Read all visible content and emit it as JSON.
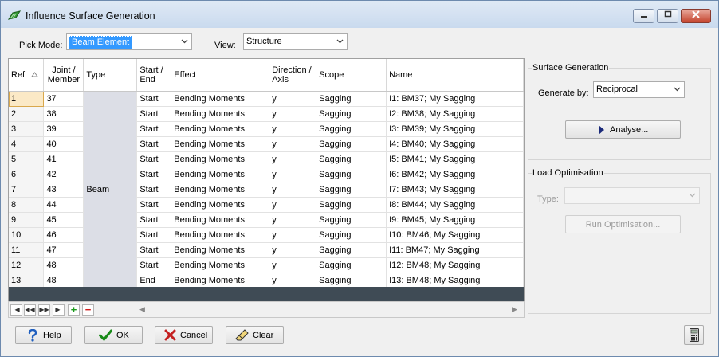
{
  "window": {
    "title": "Influence Surface Generation"
  },
  "pick_mode": {
    "label": "Pick Mode:",
    "value": "Beam Element"
  },
  "view": {
    "label": "View:",
    "value": "Structure"
  },
  "grid": {
    "headers": {
      "ref": "Ref",
      "joint_line1": "Joint /",
      "joint_line2": "Member",
      "type": "Type",
      "startend_line1": "Start /",
      "startend_line2": "End",
      "effect": "Effect",
      "direction_line1": "Direction /",
      "direction_line2": "Axis",
      "scope": "Scope",
      "name": "Name"
    },
    "type_value": "Beam",
    "rows": [
      {
        "ref": "1",
        "joint": "37",
        "se": "Start",
        "effect": "Bending Moments",
        "dir": "y",
        "scope": "Sagging",
        "name": "I1: BM37; My Sagging"
      },
      {
        "ref": "2",
        "joint": "38",
        "se": "Start",
        "effect": "Bending Moments",
        "dir": "y",
        "scope": "Sagging",
        "name": "I2: BM38; My Sagging"
      },
      {
        "ref": "3",
        "joint": "39",
        "se": "Start",
        "effect": "Bending Moments",
        "dir": "y",
        "scope": "Sagging",
        "name": "I3: BM39; My Sagging"
      },
      {
        "ref": "4",
        "joint": "40",
        "se": "Start",
        "effect": "Bending Moments",
        "dir": "y",
        "scope": "Sagging",
        "name": "I4: BM40; My Sagging"
      },
      {
        "ref": "5",
        "joint": "41",
        "se": "Start",
        "effect": "Bending Moments",
        "dir": "y",
        "scope": "Sagging",
        "name": "I5: BM41; My Sagging"
      },
      {
        "ref": "6",
        "joint": "42",
        "se": "Start",
        "effect": "Bending Moments",
        "dir": "y",
        "scope": "Sagging",
        "name": "I6: BM42; My Sagging"
      },
      {
        "ref": "7",
        "joint": "43",
        "se": "Start",
        "effect": "Bending Moments",
        "dir": "y",
        "scope": "Sagging",
        "name": "I7: BM43; My Sagging"
      },
      {
        "ref": "8",
        "joint": "44",
        "se": "Start",
        "effect": "Bending Moments",
        "dir": "y",
        "scope": "Sagging",
        "name": "I8: BM44; My Sagging"
      },
      {
        "ref": "9",
        "joint": "45",
        "se": "Start",
        "effect": "Bending Moments",
        "dir": "y",
        "scope": "Sagging",
        "name": "I9: BM45; My Sagging"
      },
      {
        "ref": "10",
        "joint": "46",
        "se": "Start",
        "effect": "Bending Moments",
        "dir": "y",
        "scope": "Sagging",
        "name": "I10: BM46; My Sagging"
      },
      {
        "ref": "11",
        "joint": "47",
        "se": "Start",
        "effect": "Bending Moments",
        "dir": "y",
        "scope": "Sagging",
        "name": "I11: BM47; My Sagging"
      },
      {
        "ref": "12",
        "joint": "48",
        "se": "Start",
        "effect": "Bending Moments",
        "dir": "y",
        "scope": "Sagging",
        "name": "I12: BM48; My Sagging"
      },
      {
        "ref": "13",
        "joint": "48",
        "se": "End",
        "effect": "Bending Moments",
        "dir": "y",
        "scope": "Sagging",
        "name": "I13: BM48; My Sagging"
      }
    ]
  },
  "surface_generation": {
    "title": "Surface Generation",
    "generate_label": "Generate by:",
    "generate_value": "Reciprocal",
    "analyse_label": "Analyse..."
  },
  "load_optimisation": {
    "title": "Load Optimisation",
    "type_label": "Type:",
    "run_label": "Run Optimisation..."
  },
  "footer": {
    "help": "Help",
    "ok": "OK",
    "cancel": "Cancel",
    "clear": "Clear"
  },
  "colors": {
    "selection": "#3399ff",
    "type_column": "#dcdee6",
    "grid_footer": "#3f4b55",
    "title_bar": "#c9daee"
  }
}
